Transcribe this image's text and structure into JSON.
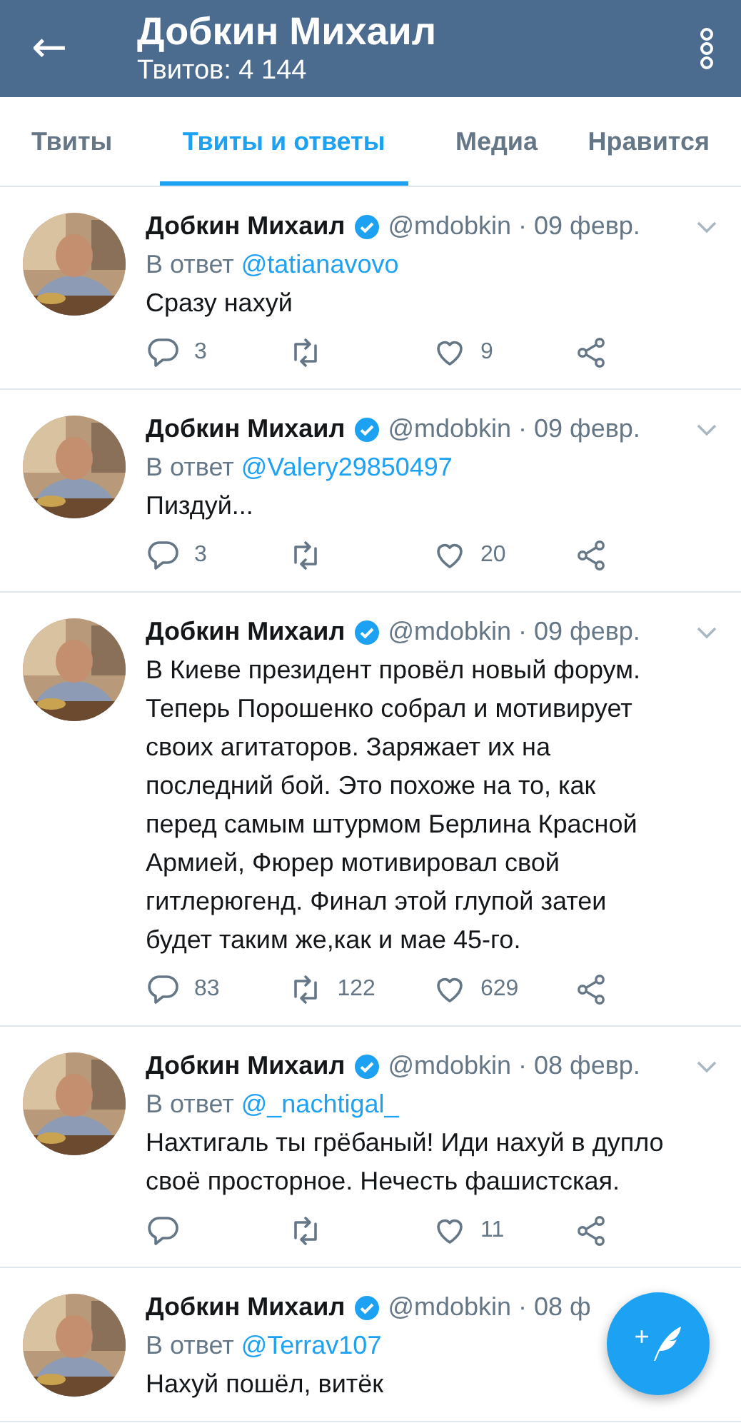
{
  "header": {
    "back": "←",
    "title": "Добкин Михаил",
    "subtitle": "Твитов: 4 144"
  },
  "tabs": [
    {
      "label": "Твиты",
      "selected": false
    },
    {
      "label": "Твиты и ответы",
      "selected": true
    },
    {
      "label": "Медиа",
      "selected": false
    },
    {
      "label": "Нравится",
      "selected": false
    }
  ],
  "tweets": [
    {
      "name": "Добкин Михаил",
      "verified": true,
      "handle": "@mdobkin · 09 февр.",
      "chevron": true,
      "reply_prefix": "В ответ",
      "reply_to": "@tatianavovo",
      "text": "Сразу нахуй",
      "actions": {
        "replies": "3",
        "likes": "9"
      }
    },
    {
      "name": "Добкин Михаил",
      "verified": true,
      "handle": "@mdobkin · 09 февр.",
      "chevron": true,
      "reply_prefix": "В ответ",
      "reply_to": "@Valery29850497",
      "text": "Пиздуй...",
      "actions": {
        "replies": "3",
        "likes": "20"
      }
    },
    {
      "name": "Добкин Михаил",
      "verified": true,
      "handle": "@mdobkin · 09 февр.",
      "chevron": true,
      "text": "В Киеве президент провёл новый форум.\nТеперь Порошенко собрал и мотивирует\nсвоих агитаторов. Заряжает их на\nпоследний бой. Это похоже на то, как\nперед самым штурмом Берлина Красной\nАрмией, Фюрер мотивировал свой\nгитлерюгенд. Финал этой глупой затеи\nбудет таким же,как и мае 45-го.",
      "actions": {
        "replies": "83",
        "retweets": "122",
        "likes": "629"
      }
    },
    {
      "name": "Добкин Михаил",
      "verified": true,
      "handle": "@mdobkin · 08 февр.",
      "chevron": true,
      "reply_prefix": "В ответ",
      "reply_to": "@_nachtigal_",
      "text": "Нахтигаль ты грёбаный! Иди нахуй в дупло\nсвоё просторное. Нечесть фашистская.",
      "actions": {
        "likes": "11"
      }
    },
    {
      "name": "Добкин Михаил",
      "verified": true,
      "handle": "@mdobkin · 08 ф",
      "chevron": false,
      "reply_prefix": "В ответ",
      "reply_to": "@Terrav107",
      "text": "Нахуй пошёл, витёк"
    }
  ],
  "compose_button": {
    "plus": "+"
  }
}
